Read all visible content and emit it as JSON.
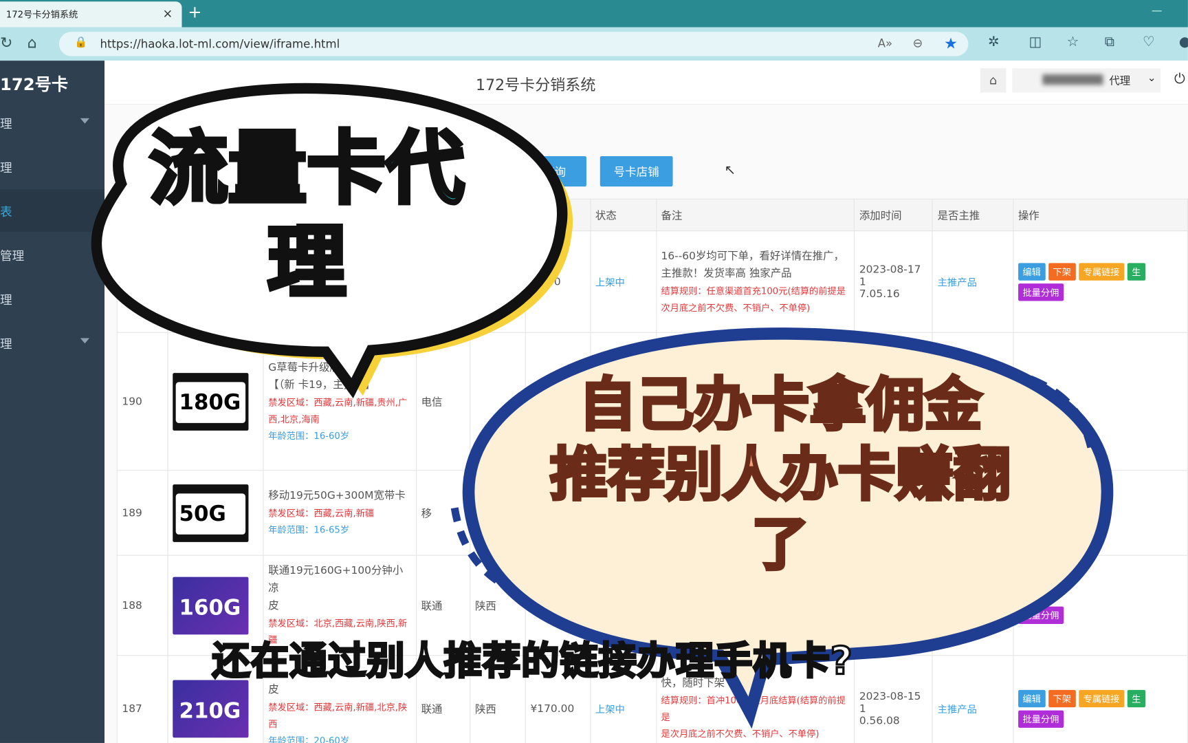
{
  "browser": {
    "tab_title": "172号卡分销系统",
    "tab_close": "×",
    "new_tab": "+",
    "url": "https://haoka.lot-ml.com/view/iframe.html"
  },
  "sidebar": {
    "logo": "172号卡",
    "items": [
      {
        "label": "理",
        "caret": true
      },
      {
        "label": "理",
        "caret": false
      },
      {
        "label": "表",
        "caret": false,
        "active": true
      },
      {
        "label": "管理",
        "caret": false
      },
      {
        "label": "理",
        "caret": false
      },
      {
        "label": "理",
        "caret": true
      }
    ]
  },
  "header": {
    "title": "172号卡分销系统",
    "user_role": "代理"
  },
  "toolbar": {
    "query_label": "查询",
    "shop_label": "号卡店铺"
  },
  "table": {
    "headers": {
      "status": "状态",
      "remark": "备注",
      "added": "添加时间",
      "main": "是否主推",
      "ops": "操作"
    },
    "row0": {
      "price": "25.00",
      "status": "上架中",
      "remark1": "16--60岁均可下单，看好详情在推广，",
      "remark2": "主推款！发货率高 独家产品",
      "rule1": "结算规则：任意渠道首充100元(结算的前提是",
      "rule2": "次月底之前不欠费、不销户、不单停)",
      "date1": "2023-08-17 1",
      "date2": "7.05.16",
      "main": "主推产品"
    },
    "row190": {
      "id": "190",
      "img_text": "180G",
      "name1": "G草莓卡升级版",
      "name2": "【（新",
      "name3": "卡19，主推款】",
      "area1": "禁发区域：西藏,云南,新疆,贵州,广",
      "area2": "西,北京,海南",
      "age": "年龄范围：16-60岁",
      "carrier": "电信"
    },
    "row189": {
      "id": "189",
      "img_text": "50G",
      "name": "移动19元50G+300M宽带卡",
      "area": "禁发区域：西藏,云南,新疆",
      "age": "年龄范围：16-65岁",
      "carrier": "移"
    },
    "row188": {
      "id": "188",
      "img_text": "160G",
      "name1": "联通19元160G+100分钟小凉",
      "name2": "皮",
      "area1": "禁发区域：北京,西藏,云南,陕西,新",
      "area2": "疆",
      "carrier": "联通",
      "province": "陕西"
    },
    "row187": {
      "id": "187",
      "img_text": "210G",
      "name2": "皮",
      "area1": "禁发区域：西藏,云南,新疆,北京,陕",
      "area2": "西",
      "age": "年龄范围：20-60岁",
      "carrier": "联通",
      "province": "陕西",
      "price": "¥170.00",
      "status": "上架中",
      "remark1": "快，随时下架",
      "rule1": "结算规则：首冲100，次月底结算(结算的前提是",
      "rule2": "是次月底之前不欠费、不销户、不单停)",
      "date1": "2023-08-15 1",
      "date2": "0.56.08",
      "main": "主推产品"
    },
    "ops": {
      "edit": "编辑",
      "down": "下架",
      "link": "专属链接",
      "gen": "生",
      "batch": "批量分佣"
    }
  },
  "overlay": {
    "bubble1_line1": "流量卡代",
    "bubble1_line2": "理",
    "bubble2_line1": "自己办卡拿佣金",
    "bubble2_line2": "推荐别人办卡赚翻",
    "bubble2_line3": "了",
    "caption": "还在通过别人推荐的链接办理手机卡?"
  },
  "colors": {
    "accent": "#3a9ee0",
    "sidebar": "#2f4050",
    "bubble1_text": "#18c4dc",
    "bubble2_fill": "#fdf0d6"
  }
}
